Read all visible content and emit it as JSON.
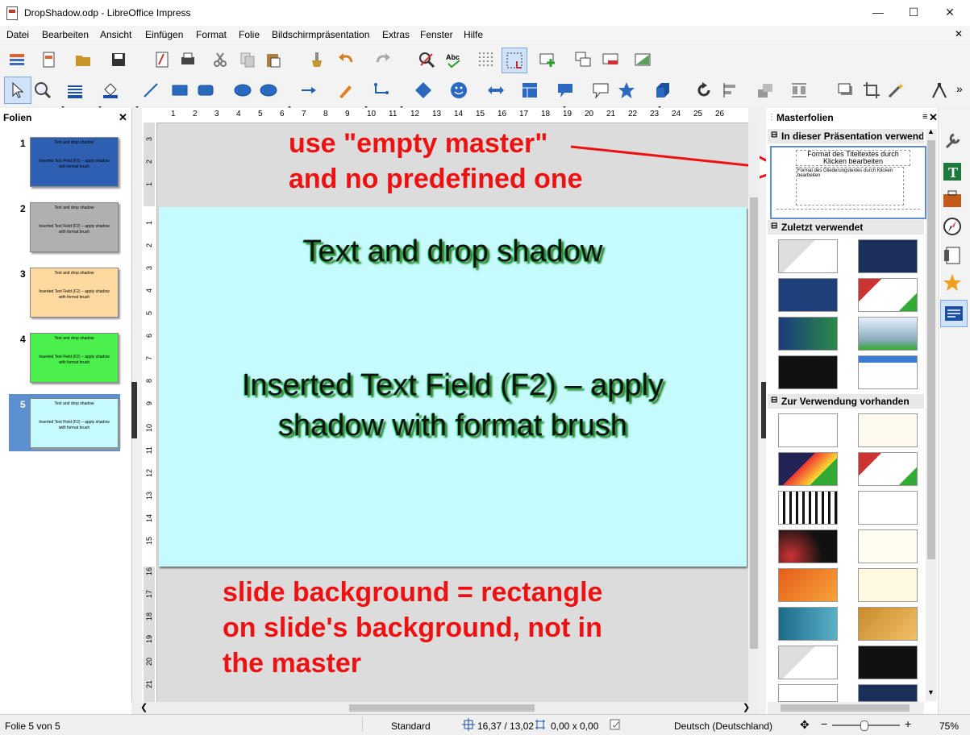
{
  "window": {
    "title": "DropShadow.odp - LibreOffice Impress",
    "minimize_icon": "minimize-icon",
    "maximize_icon": "maximize-icon",
    "close_icon": "close-icon"
  },
  "menu": [
    "Datei",
    "Bearbeiten",
    "Ansicht",
    "Einfügen",
    "Format",
    "Folie",
    "Bildschirmpräsentation",
    "Extras",
    "Fenster",
    "Hilfe"
  ],
  "slides_panel": {
    "title": "Folien",
    "close": "✕",
    "slides": [
      {
        "num": "1",
        "title": "Text and drop shadow",
        "body": "Inserted Text Field (F2) – apply shadow with format brush",
        "bg": "#2f5fb0"
      },
      {
        "num": "2",
        "title": "Text and drop shadow",
        "body": "Inserted Text Field (F2) – apply shadow with format brush",
        "bg": "#b0b0b0"
      },
      {
        "num": "3",
        "title": "Text and drop shadow",
        "body": "Inserted Text Field (F2) – apply shadow with format brush",
        "bg": "#ffd9a0"
      },
      {
        "num": "4",
        "title": "Text and drop shadow",
        "body": "Inserted Text Field (F2) – apply shadow with format brush",
        "bg": "#4cf04c"
      },
      {
        "num": "5",
        "title": "Text and drop shadow",
        "body": "Inserted Text Field (F2) – apply shadow with format brush",
        "bg": "#c5fbfc"
      }
    ]
  },
  "rulers": {
    "h_ticks": [
      "1",
      "2",
      "3",
      "4",
      "5",
      "6",
      "7",
      "8",
      "9",
      "10",
      "11",
      "12",
      "13",
      "14",
      "15",
      "16",
      "17",
      "18",
      "19",
      "20",
      "21",
      "22",
      "23",
      "24",
      "25",
      "26"
    ],
    "v_ticks_top": [
      "3",
      "2",
      "1"
    ],
    "v_ticks_slide": [
      "1",
      "2",
      "3",
      "4",
      "5",
      "6",
      "7",
      "8",
      "9",
      "10",
      "11",
      "12",
      "13",
      "14",
      "15"
    ],
    "v_ticks_bottom": [
      "16",
      "17",
      "18",
      "19",
      "20",
      "21"
    ]
  },
  "slide": {
    "title": "Text and drop shadow",
    "body_line1": "Inserted Text Field (F2) – apply",
    "body_line2": "shadow with format brush"
  },
  "annotations": {
    "top_line1": "use \"empty master\"",
    "top_line2": "and no predefined one",
    "bottom_line1": "slide background = rectangle",
    "bottom_line2": "on slide's background, not in",
    "bottom_line3": "the master"
  },
  "master_panel": {
    "title": "Masterfolien",
    "menu_icon": "≡",
    "close": "✕",
    "section_used": "In dieser Präsentation verwendet",
    "used_thumb_title": "Format des Titeltextes durch Klicken bearbeiten",
    "used_thumb_body": "Format des Gliederungstextes durch Klicken bearbeiten",
    "section_recent": "Zuletzt verwendet",
    "section_available": "Zur Verwendung vorhanden"
  },
  "statusbar": {
    "slide_info": "Folie 5 von 5",
    "master_name": "Standard",
    "position": "16,37 / 13,02",
    "size": "0,00 x 0,00",
    "language": "Deutsch (Deutschland)",
    "zoom": "75%"
  },
  "colors": {
    "annotation": "#ee1111",
    "slide_bg": "#c5fbfc",
    "shadow": "#1a7a1a"
  }
}
